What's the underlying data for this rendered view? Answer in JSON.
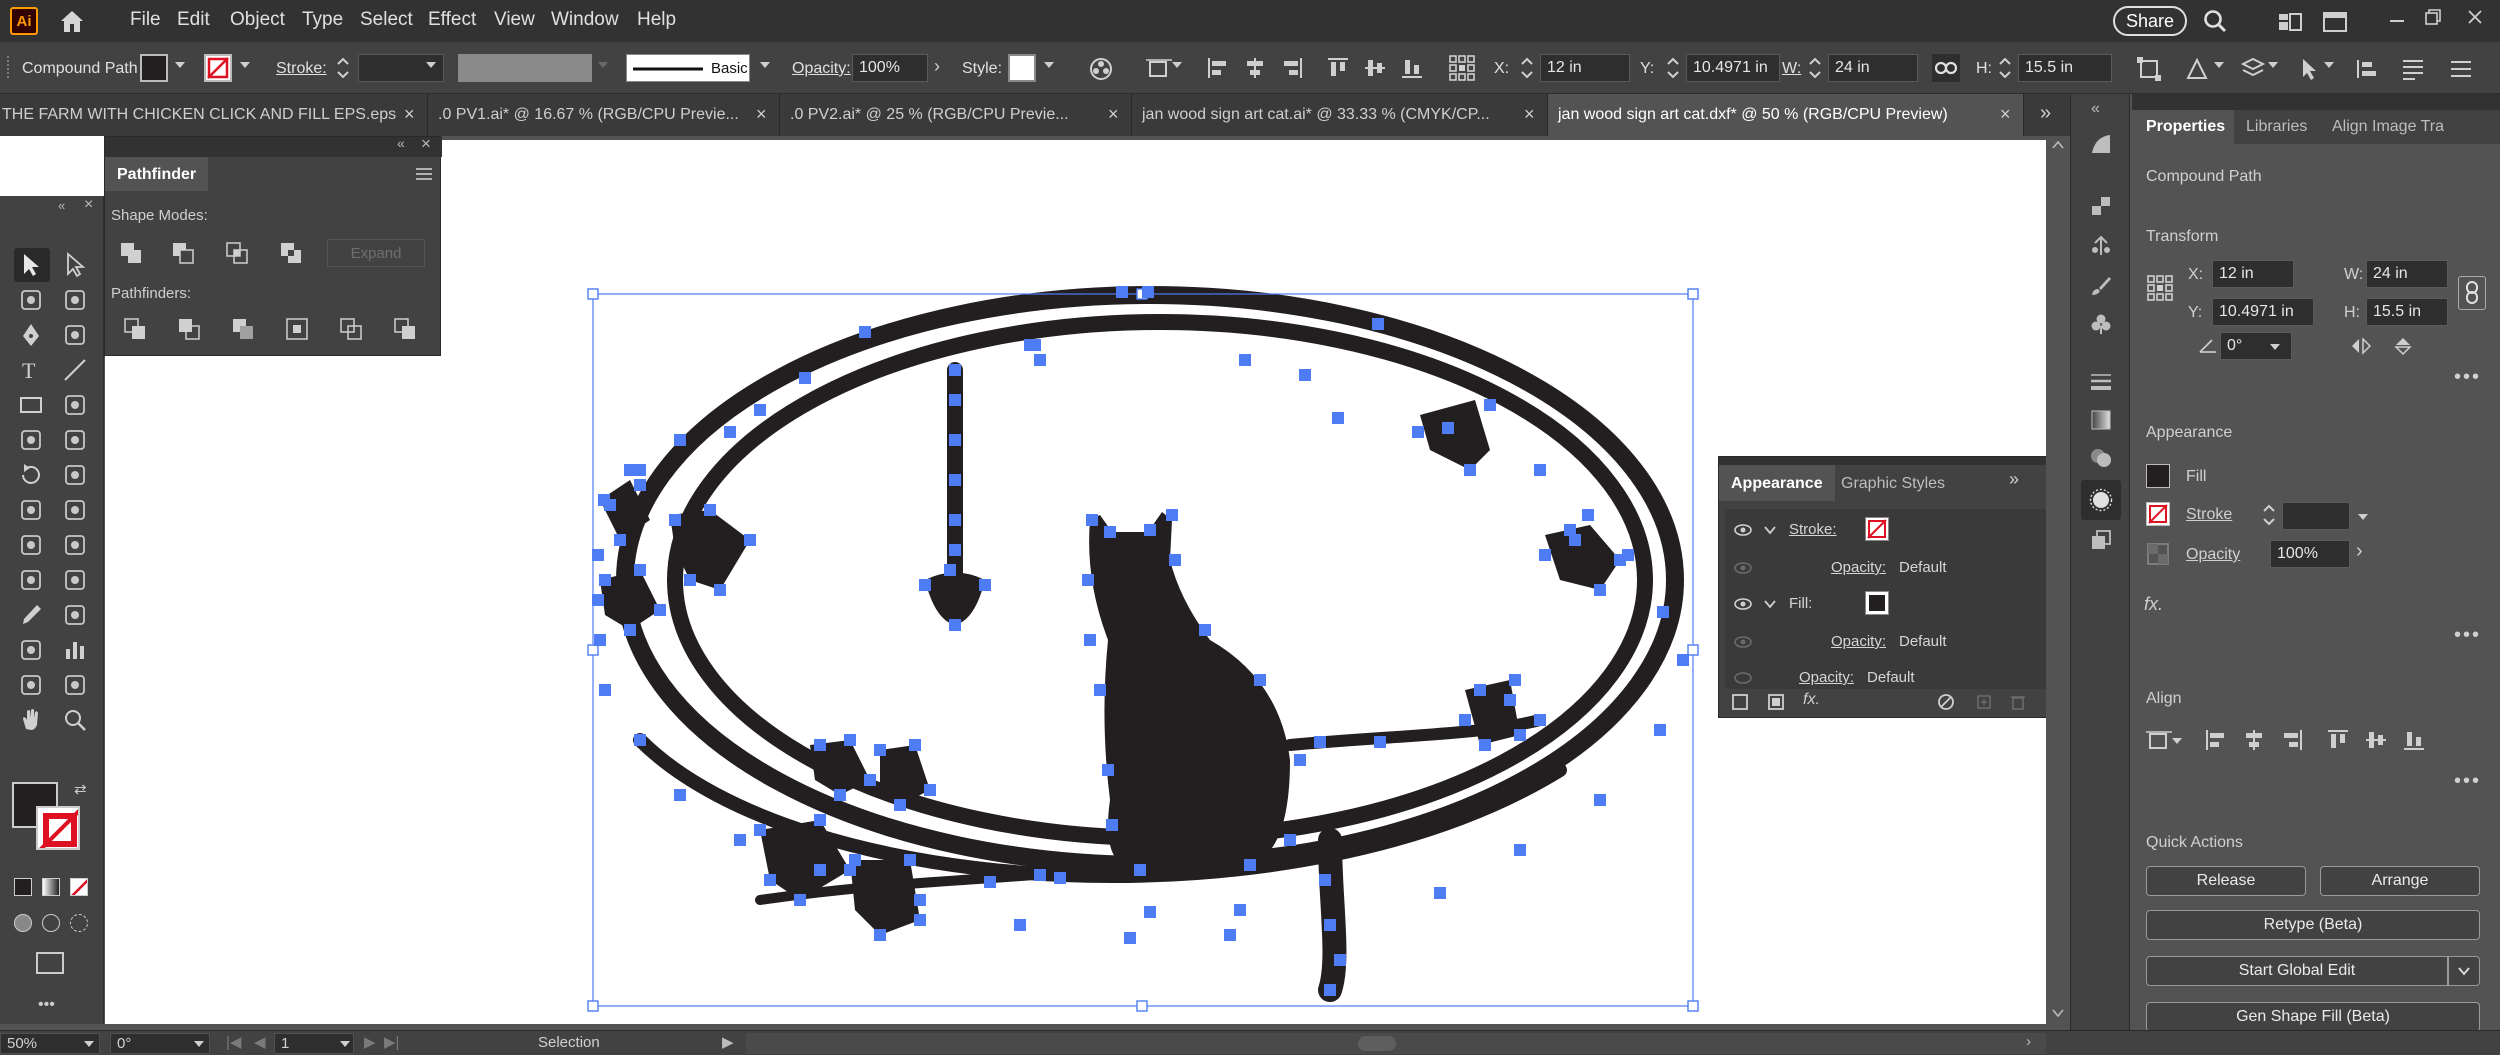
{
  "app": {
    "logo": "Ai",
    "share_label": "Share"
  },
  "menu": [
    "File",
    "Edit",
    "Object",
    "Type",
    "Select",
    "Effect",
    "View",
    "Window",
    "Help"
  ],
  "control": {
    "selection_type": "Compound Path",
    "stroke_label": "Stroke:",
    "brush_label": "Basic",
    "opacity_label": "Opacity:",
    "opacity_value": "100%",
    "style_label": "Style:",
    "x_label": "X:",
    "x_value": "12 in",
    "y_label": "Y:",
    "y_value": "10.4971 in",
    "w_label": "W:",
    "w_value": "24 in",
    "h_label": "H:",
    "h_value": "15.5 in"
  },
  "tabs": [
    {
      "label": "THE FARM WITH CHICKEN CLICK AND FILL EPS.eps"
    },
    {
      "label": ".0 PV1.ai* @ 16.67 % (RGB/CPU Previe..."
    },
    {
      "label": ".0 PV2.ai* @ 25 % (RGB/CPU Previe..."
    },
    {
      "label": "jan wood sign art cat.ai* @ 33.33 % (CMYK/CP..."
    },
    {
      "label": "jan wood sign art cat.dxf* @ 50 % (RGB/CPU Preview)"
    }
  ],
  "pathfinder": {
    "title": "Pathfinder",
    "shape_modes_label": "Shape Modes:",
    "expand_label": "Expand",
    "pathfinders_label": "Pathfinders:"
  },
  "appearance": {
    "tab_active": "Appearance",
    "tab_inactive": "Graphic Styles",
    "stroke_label": "Stroke:",
    "opacity_label": "Opacity:",
    "default_label": "Default",
    "fill_label": "Fill:",
    "fx_label": "fx."
  },
  "properties": {
    "tabs": [
      "Properties",
      "Libraries",
      "Align",
      "Image Tra"
    ],
    "object_type": "Compound Path",
    "transform_title": "Transform",
    "x_label": "X:",
    "x_value": "12 in",
    "y_label": "Y:",
    "y_value": "10.4971 in",
    "w_label": "W:",
    "w_value": "24 in",
    "h_label": "H:",
    "h_value": "15.5 in",
    "rotate_value": "0°",
    "appearance_title": "Appearance",
    "fill_label": "Fill",
    "stroke_label": "Stroke",
    "opacity_label": "Opacity",
    "opacity_value": "100%",
    "fx_label": "fx.",
    "align_title": "Align",
    "quick_actions_title": "Quick Actions",
    "release_label": "Release",
    "arrange_label": "Arrange",
    "retype_label": "Retype (Beta)",
    "global_edit_label": "Start Global Edit",
    "gen_fill_label": "Gen Shape Fill (Beta)"
  },
  "status": {
    "zoom": "50%",
    "rotation": "0°",
    "artboard": "1",
    "tool": "Selection"
  },
  "colors": {
    "selection": "#4d7cf5",
    "art": "#231f20"
  }
}
